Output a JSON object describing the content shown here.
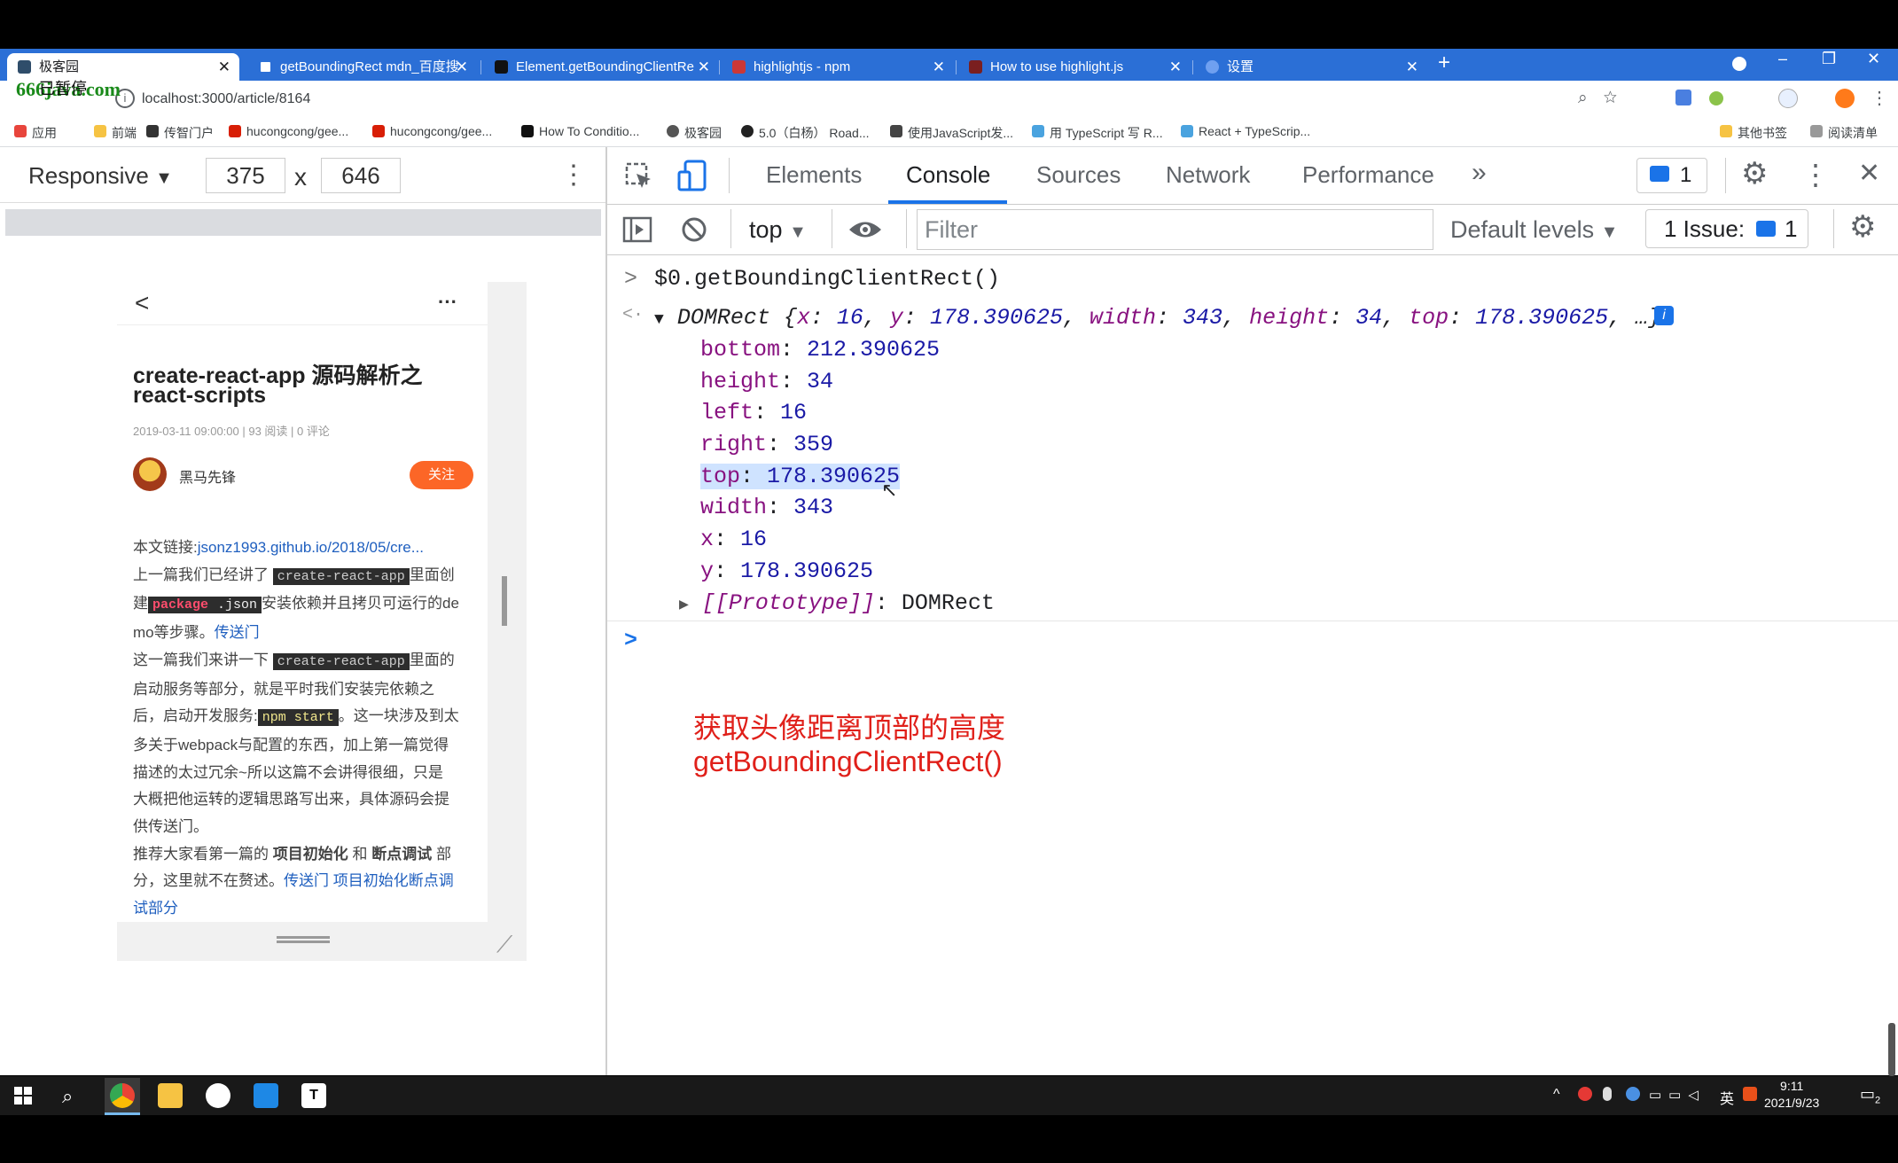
{
  "browser": {
    "tabs": [
      {
        "title": "极客园",
        "active": true
      },
      {
        "title": "getBoundingRect mdn_百度搜"
      },
      {
        "title": "Element.getBoundingClientRe"
      },
      {
        "title": "highlightjs - npm"
      },
      {
        "title": "How to use highlight.js"
      },
      {
        "title": "设置"
      }
    ],
    "url": "localhost:3000/article/8164",
    "bookmarks": [
      "应用",
      "前端",
      "传智门户",
      "hucongcong/gee...",
      "hucongcong/gee...",
      "How To Conditio...",
      "极客园",
      "5.0（白杨） Road...",
      "使用JavaScript发...",
      "用 TypeScript 写 R...",
      "React + TypeScrip..."
    ],
    "bookmarks_right": [
      "其他书签",
      "阅读清单"
    ],
    "watermark": "666java.com",
    "watermark_overlay": "已暂停"
  },
  "device_toolbar": {
    "mode": "Responsive",
    "width": "375",
    "height": "646",
    "times": "x"
  },
  "article": {
    "back": "<",
    "more": "···",
    "title_line1": "create-react-app 源码解析之",
    "title_line2": "react-scripts",
    "meta": "2019-03-11 09:00:00 | 93 阅读 | 0 评论",
    "author": "黑马先锋",
    "follow_label": "关注",
    "link_prefix": "本文链接:",
    "link_text": "jsonz1993.github.io/2018/05/cre...",
    "p1_a": "上一篇我们已经讲了",
    "p1_code1": "create-react-app",
    "p1_b": "里面创",
    "p1_c": "建",
    "p1_code2a": "package",
    "p1_code2b": ".json",
    "p1_d": "安装依赖并且拷贝可运行的de",
    "p1_e": "mo等步骤。",
    "p1_link": "传送门",
    "p2_a": "这一篇我们来讲一下",
    "p2_code": "create-react-app",
    "p2_b": "里面的",
    "p2_c": "启动服务等部分，就是平时我们安装完依赖之",
    "p2_d": "后，启动开发服务:",
    "p2_code2": "npm start",
    "p2_e": "。这一块涉及到太",
    "p2_f": "多关于webpack与配置的东西，加上第一篇觉得",
    "p2_g": "描述的太过冗余~所以这篇不会讲得很细，只是",
    "p2_h": "大概把他运转的逻辑思路写出来，具体源码会提",
    "p2_i": "供传送门。",
    "p3_a": "推荐大家看第一篇的",
    "p3_b1": "项目初始化",
    "p3_b2": "和",
    "p3_b3": "断点调试",
    "p3_c": "部",
    "p3_d": "分，这里就不在赘述。",
    "p3_link1": "传送门 项目初始化断点调",
    "p3_link2": "试部分"
  },
  "devtools": {
    "tabs": [
      "Elements",
      "Console",
      "Sources",
      "Network",
      "Performance"
    ],
    "active_tab": "Console",
    "more": "»",
    "issues_badge": "1",
    "context": "top",
    "filter_placeholder": "Filter",
    "levels": "Default levels",
    "issue_label": "1 Issue:",
    "issue_count": "1",
    "console": {
      "command": "$0.getBoundingClientRect()",
      "summary_prefix": "DOMRect {",
      "summary": [
        {
          "k": "x",
          "v": "16"
        },
        {
          "k": "y",
          "v": "178.390625"
        },
        {
          "k": "width",
          "v": "343"
        },
        {
          "k": "height",
          "v": "34"
        },
        {
          "k": "top",
          "v": "178.390625"
        }
      ],
      "summary_suffix": "…}",
      "props": [
        {
          "k": "bottom",
          "v": "212.390625"
        },
        {
          "k": "height",
          "v": "34"
        },
        {
          "k": "left",
          "v": "16"
        },
        {
          "k": "right",
          "v": "359"
        },
        {
          "k": "top",
          "v": "178.390625",
          "highlighted": true
        },
        {
          "k": "width",
          "v": "343"
        },
        {
          "k": "x",
          "v": "16"
        },
        {
          "k": "y",
          "v": "178.390625"
        }
      ],
      "prototype_key": "[[Prototype]]",
      "prototype_val": "DOMRect"
    }
  },
  "annotation": {
    "line1": "获取头像距离顶部的高度",
    "line2": "getBoundingClientRect()"
  },
  "taskbar": {
    "time": "9:11",
    "date": "2021/9/23",
    "ime": "英",
    "notifications": "2"
  }
}
